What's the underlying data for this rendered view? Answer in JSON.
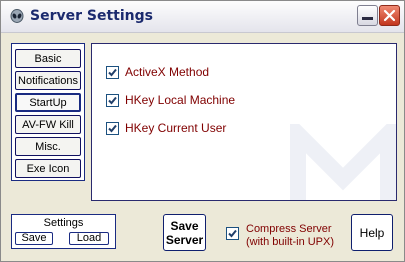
{
  "window": {
    "title": "Server Settings"
  },
  "nav": {
    "items": [
      {
        "label": "Basic",
        "active": false
      },
      {
        "label": "Notifications",
        "active": false
      },
      {
        "label": "StartUp",
        "active": true
      },
      {
        "label": "AV-FW Kill",
        "active": false
      },
      {
        "label": "Misc.",
        "active": false
      },
      {
        "label": "Exe Icon",
        "active": false
      }
    ]
  },
  "startup": {
    "options": [
      {
        "label": "ActiveX Method",
        "checked": true
      },
      {
        "label": "HKey Local Machine",
        "checked": true
      },
      {
        "label": "HKey Current User",
        "checked": true
      }
    ]
  },
  "settings": {
    "title": "Settings",
    "save_label": "Save",
    "load_label": "Load"
  },
  "actions": {
    "save_server_line1": "Save",
    "save_server_line2": "Server",
    "compress_line1": "Compress Server",
    "compress_line2": "(with built-in UPX)",
    "compress_checked": true,
    "help_label": "Help"
  },
  "colors": {
    "option_text": "#800000",
    "border_blue": "#1a2b82",
    "title_text": "#1b2a6e"
  }
}
